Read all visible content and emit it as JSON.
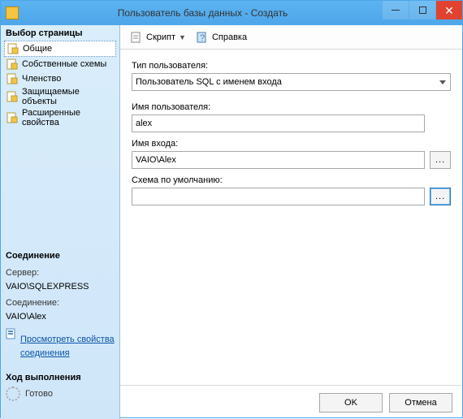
{
  "window": {
    "title": "Пользователь базы данных - Создать"
  },
  "left": {
    "pages_title": "Выбор страницы",
    "pages": [
      {
        "label": "Общие",
        "selected": true
      },
      {
        "label": "Собственные схемы",
        "selected": false
      },
      {
        "label": "Членство",
        "selected": false
      },
      {
        "label": "Защищаемые объекты",
        "selected": false
      },
      {
        "label": "Расширенные свойства",
        "selected": false
      }
    ],
    "connection_title": "Соединение",
    "server_label": "Сервер:",
    "server_value": "VAIO\\SQLEXPRESS",
    "conn_label": "Соединение:",
    "conn_value": "VAIO\\Alex",
    "view_props": "Просмотреть свойства соединения",
    "progress_title": "Ход выполнения",
    "progress_text": "Готово"
  },
  "toolbar": {
    "script": "Скрипт",
    "help": "Справка"
  },
  "form": {
    "user_type_label": "Тип пользователя:",
    "user_type_value": "Пользователь SQL с именем входа",
    "username_label": "Имя пользователя:",
    "username_value": "alex",
    "login_label": "Имя входа:",
    "login_value": "VAIO\\Alex",
    "schema_label": "Схема по умолчанию:",
    "schema_value": "",
    "browse": "..."
  },
  "buttons": {
    "ok": "OK",
    "cancel": "Отмена"
  }
}
